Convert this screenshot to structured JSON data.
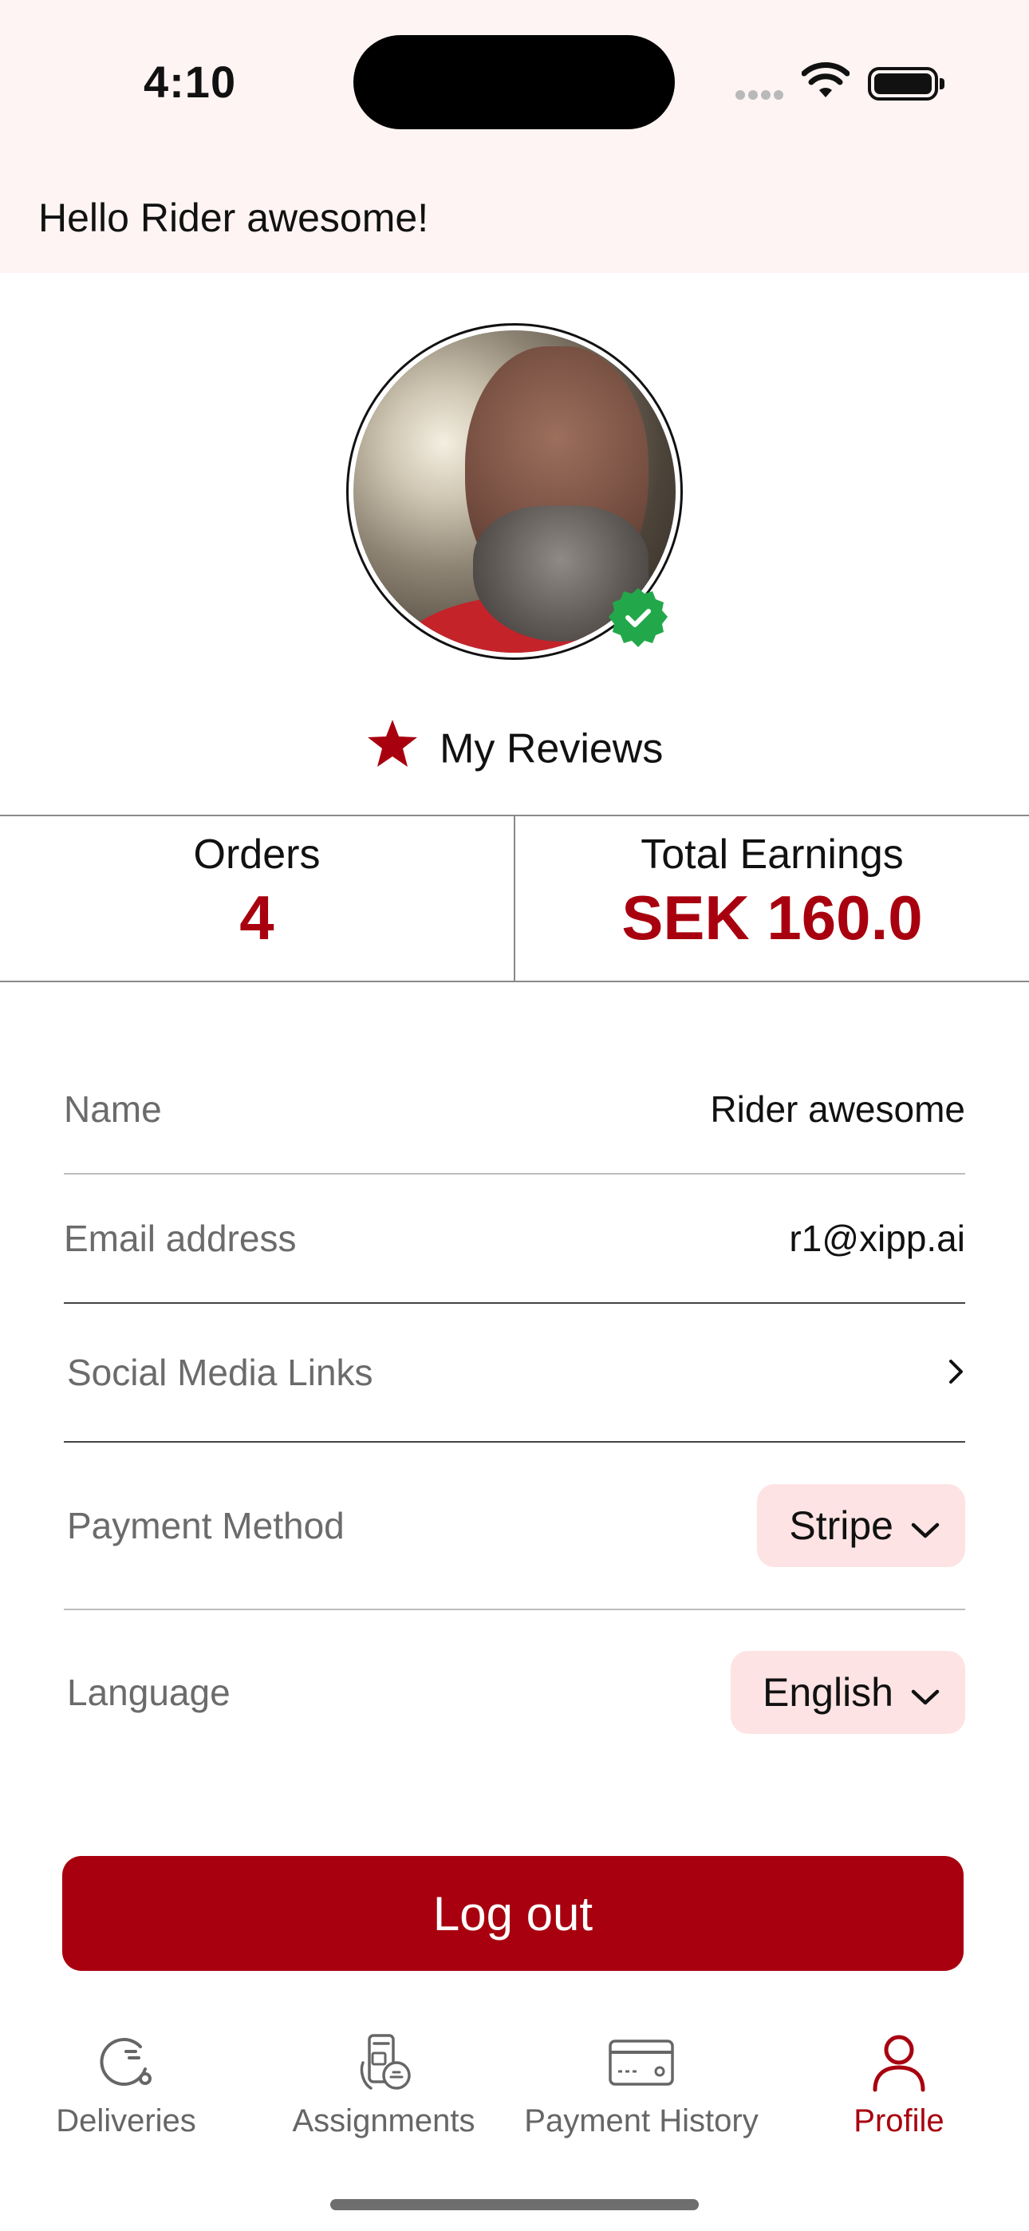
{
  "status_bar": {
    "time": "4:10"
  },
  "header": {
    "greeting": "Hello Rider awesome!"
  },
  "profile": {
    "reviews_label": "My Reviews"
  },
  "stats": {
    "orders_label": "Orders",
    "orders_value": "4",
    "earnings_label": "Total Earnings",
    "earnings_value": "SEK 160.0"
  },
  "fields": {
    "name_label": "Name",
    "name_value": "Rider awesome",
    "email_label": "Email address",
    "email_value": "r1@xipp.ai",
    "social_label": "Social Media Links",
    "payment_label": "Payment Method",
    "payment_value": "Stripe",
    "language_label": "Language",
    "language_value": "English"
  },
  "actions": {
    "logout_label": "Log out"
  },
  "tabs": [
    {
      "label": "Deliveries",
      "icon": "deliveries-icon"
    },
    {
      "label": "Assignments",
      "icon": "assignments-icon"
    },
    {
      "label": "Payment History",
      "icon": "payment-history-icon"
    },
    {
      "label": "Profile",
      "icon": "profile-icon"
    }
  ],
  "colors": {
    "accent": "#a8000f",
    "header_bg": "#fdf4f3",
    "pill_bg": "#fde3e3",
    "verified": "#22a84a"
  }
}
